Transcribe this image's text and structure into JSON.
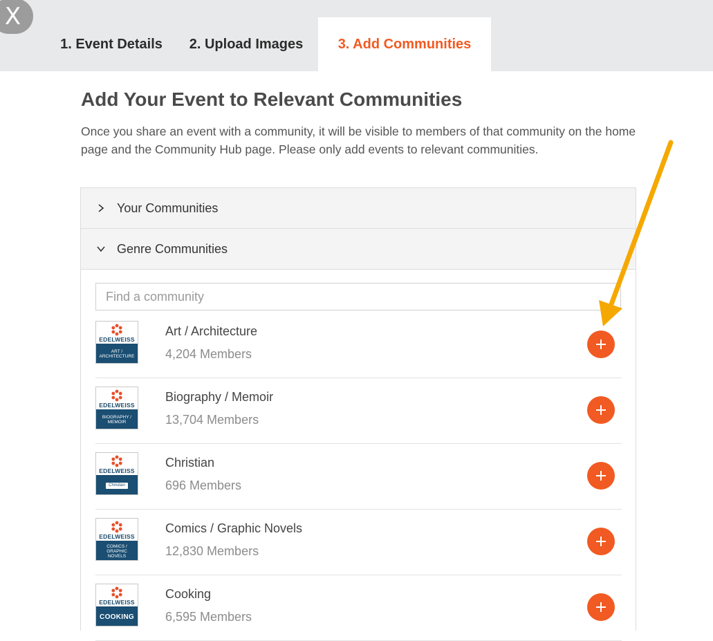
{
  "window": {
    "close_label": "X"
  },
  "tabs": [
    {
      "label": "1. Event Details",
      "active": false
    },
    {
      "label": "2. Upload Images",
      "active": false
    },
    {
      "label": "3. Add Communities",
      "active": true
    }
  ],
  "main": {
    "title": "Add Your Event to Relevant Communities",
    "intro": "Once you share an event with a community, it will be visible to members of that community on the home page and the Community Hub page. Please only add events to relevant communities."
  },
  "accordion": {
    "your_communities": {
      "label": "Your Communities",
      "expanded": false
    },
    "genre_communities": {
      "label": "Genre Communities",
      "expanded": true
    }
  },
  "search": {
    "placeholder": "Find a community",
    "value": ""
  },
  "communities": [
    {
      "name": "Art / Architecture",
      "members": "4,204 Members",
      "logo_brand": "EDELWEISS",
      "logo_band": "ART / ARCHITECTURE"
    },
    {
      "name": "Biography / Memoir",
      "members": "13,704 Members",
      "logo_brand": "EDELWEISS",
      "logo_band": "BIOGRAPHY / MEMOIR"
    },
    {
      "name": "Christian",
      "members": "696 Members",
      "logo_brand": "EDELWEISS",
      "logo_band": "Christian"
    },
    {
      "name": "Comics / Graphic Novels",
      "members": "12,830 Members",
      "logo_brand": "EDELWEISS",
      "logo_band": "COMICS / GRAPHIC NOVELS"
    },
    {
      "name": "Cooking",
      "members": "6,595 Members",
      "logo_brand": "EDELWEISS",
      "logo_band": "COOKING"
    }
  ],
  "colors": {
    "accent": "#f15a22",
    "tab_bar": "#e8e9ea",
    "logo_band": "#1a4e72",
    "annotation_arrow": "#f5a800"
  },
  "icons": {
    "close": "close-icon",
    "collapsed": "chevron-right-icon",
    "expanded": "chevron-down-icon",
    "add": "plus-icon",
    "logo": "edelweiss-flower-icon"
  }
}
